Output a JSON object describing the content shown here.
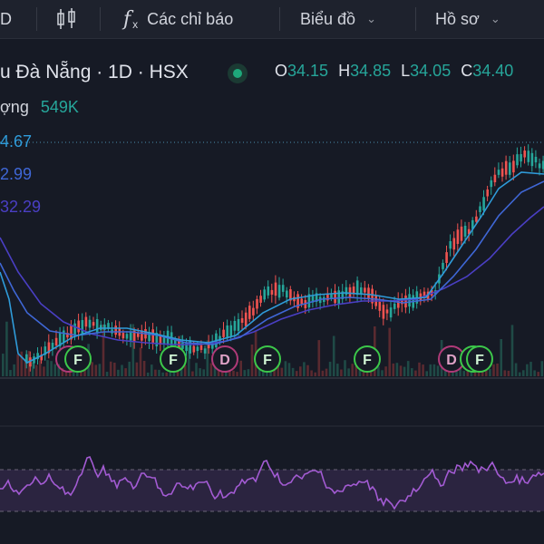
{
  "toolbar": {
    "interval_label": "D",
    "indicators_label": "Các chỉ báo",
    "chart_type_label": "Biểu đồ",
    "profile_label": "Hồ sơ"
  },
  "legend": {
    "symbol_text": "u Đà Nẵng · 1D · HSX",
    "open_key": "O",
    "open_value": "34.15",
    "high_key": "H",
    "high_value": "34.85",
    "low_key": "L",
    "low_value": "34.05",
    "close_key": "C",
    "close_value": "34.40",
    "volume_label": "ợng",
    "volume_value": "549K",
    "ma1_value": "4.67",
    "ma2_value": "2.99",
    "ma3_value": "32.29"
  },
  "events": [
    {
      "type": "F",
      "color": "#7b2a5c"
    },
    {
      "type": "F"
    },
    {
      "type": "F"
    },
    {
      "type": "D"
    },
    {
      "type": "F"
    },
    {
      "type": "F"
    },
    {
      "type": "D"
    },
    {
      "type": "F"
    },
    {
      "type": "F"
    }
  ],
  "colors": {
    "ma1": "#2f9bd9",
    "ma2": "#3f67d6",
    "ma3": "#4a3fc4",
    "up": "#26a69a",
    "down": "#ef5350",
    "rsi": "#a35bd3",
    "event_f": "#3cc84a",
    "event_d": "#b03a78"
  }
}
